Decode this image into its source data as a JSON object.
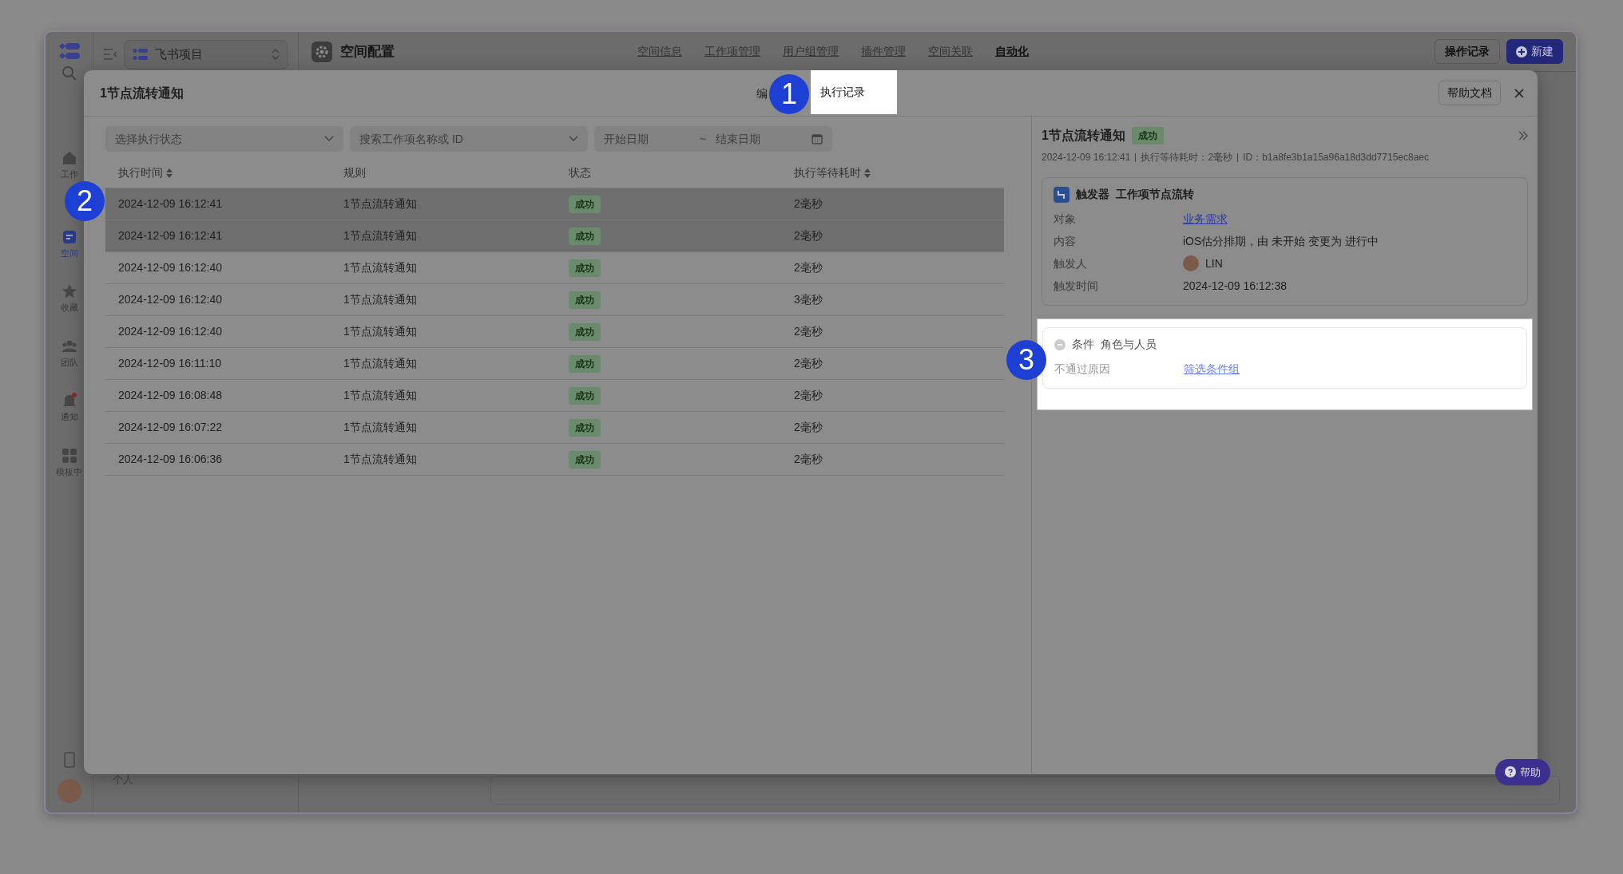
{
  "app": {
    "sidebar": [
      {
        "label": "工作",
        "selected": false
      },
      {
        "label": "空间",
        "selected": true
      },
      {
        "label": "收藏",
        "selected": false
      },
      {
        "label": "团队",
        "selected": false
      },
      {
        "label": "通知",
        "selected": false
      },
      {
        "label": "模板中",
        "selected": false
      }
    ],
    "project": "飞书项目",
    "personal_label": "个人",
    "section_title": "空间配置",
    "nav": [
      {
        "label": "空间信息",
        "selected": false
      },
      {
        "label": "工作项管理",
        "selected": false
      },
      {
        "label": "用户组管理",
        "selected": false
      },
      {
        "label": "插件管理",
        "selected": false
      },
      {
        "label": "空间关联",
        "selected": false
      },
      {
        "label": "自动化",
        "selected": true
      }
    ],
    "history_button": "操作记录",
    "new_button": "新建",
    "help_button": "帮助"
  },
  "modal": {
    "title": "1节点流转通知",
    "tabs": [
      {
        "label": "编",
        "selected": false
      },
      {
        "label": "执行记录",
        "selected": true
      }
    ],
    "help_doc_button": "帮助文档",
    "filters": {
      "status_placeholder": "选择执行状态",
      "search_placeholder": "搜索工作项名称或 ID",
      "start_placeholder": "开始日期",
      "separator": "~",
      "end_placeholder": "结束日期"
    },
    "columns": [
      {
        "label": "执行时间",
        "sortable": true
      },
      {
        "label": "规则",
        "sortable": false
      },
      {
        "label": "状态",
        "sortable": false
      },
      {
        "label": "执行等待耗时",
        "sortable": true
      }
    ],
    "rows": [
      {
        "time": "2024-12-09 16:12:41",
        "rule": "1节点流转通知",
        "status": "成功",
        "duration": "2毫秒",
        "selected": true
      },
      {
        "time": "2024-12-09 16:12:41",
        "rule": "1节点流转通知",
        "status": "成功",
        "duration": "2毫秒",
        "selected": true
      },
      {
        "time": "2024-12-09 16:12:40",
        "rule": "1节点流转通知",
        "status": "成功",
        "duration": "2毫秒",
        "selected": false
      },
      {
        "time": "2024-12-09 16:12:40",
        "rule": "1节点流转通知",
        "status": "成功",
        "duration": "3毫秒",
        "selected": false
      },
      {
        "time": "2024-12-09 16:12:40",
        "rule": "1节点流转通知",
        "status": "成功",
        "duration": "2毫秒",
        "selected": false
      },
      {
        "time": "2024-12-09 16:11:10",
        "rule": "1节点流转通知",
        "status": "成功",
        "duration": "2毫秒",
        "selected": false
      },
      {
        "time": "2024-12-09 16:08:48",
        "rule": "1节点流转通知",
        "status": "成功",
        "duration": "2毫秒",
        "selected": false
      },
      {
        "time": "2024-12-09 16:07:22",
        "rule": "1节点流转通知",
        "status": "成功",
        "duration": "2毫秒",
        "selected": false
      },
      {
        "time": "2024-12-09 16:06:36",
        "rule": "1节点流转通知",
        "status": "成功",
        "duration": "2毫秒",
        "selected": false
      }
    ],
    "detail": {
      "title": "1节点流转通知",
      "status": "成功",
      "meta": [
        "2024-12-09 16:12:41",
        "执行等待耗时：2毫秒",
        "ID：b1a8fe3b1a15a96a18d3dd7715ec8aec"
      ],
      "trigger": {
        "label": "触发器",
        "name": "工作项节点流转",
        "highlighted": false,
        "fields": [
          {
            "label": "对象",
            "value": "业务需求",
            "kind": "link"
          },
          {
            "label": "内容",
            "value": "iOS估分排期，由 未开始 变更为 进行中",
            "kind": "text"
          },
          {
            "label": "触发人",
            "value": "LIN",
            "kind": "user"
          },
          {
            "label": "触发时间",
            "value": "2024-12-09 16:12:38",
            "kind": "text"
          }
        ]
      },
      "condition": {
        "label": "条件",
        "name": "角色与人员",
        "highlighted": true,
        "fields": [
          {
            "label": "不通过原因",
            "value": "筛选条件组",
            "kind": "link"
          }
        ]
      }
    }
  },
  "callouts": [
    "1",
    "2",
    "3"
  ]
}
